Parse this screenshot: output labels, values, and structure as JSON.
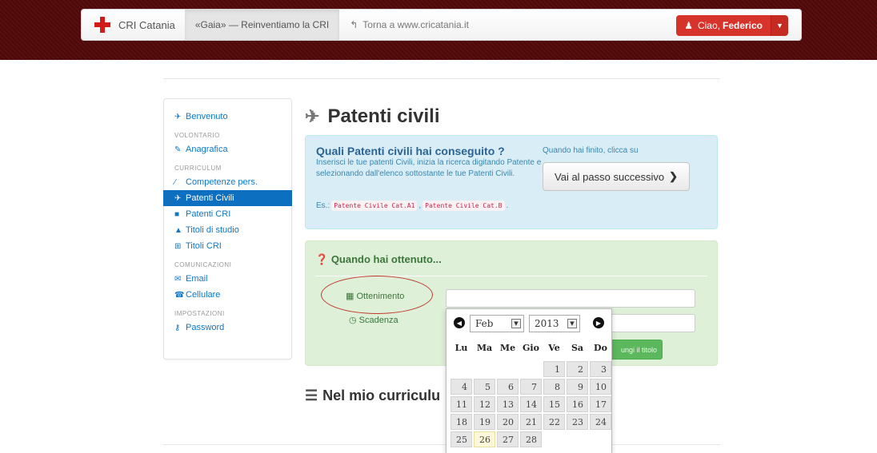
{
  "navbar": {
    "brand": "CRI Catania",
    "tab_active": "«Gaia» — Reinventiamo la CRI",
    "back_link": "Torna a www.cricatania.it",
    "user_greeting": "Ciao,",
    "user_name": "Federico"
  },
  "sidebar": {
    "welcome": "Benvenuto",
    "sections": [
      {
        "heading": "VOLONTARIO",
        "items": [
          "Anagrafica"
        ]
      },
      {
        "heading": "CURRICULUM",
        "items": [
          "Competenze pers.",
          "Patenti Civili",
          "Patenti CRI",
          "Titoli di studio",
          "Titoli CRI"
        ]
      },
      {
        "heading": "COMUNICAZIONI",
        "items": [
          "Email",
          "Cellulare"
        ]
      },
      {
        "heading": "IMPOSTAZIONI",
        "items": [
          "Password"
        ]
      }
    ],
    "active_item": "Patenti Civili"
  },
  "main": {
    "title": "Patenti civili",
    "info": {
      "title": "Quali Patenti civili hai conseguito ?",
      "text": "Inserisci le tue patenti Civili, inizia la ricerca digitando Patente e selezionando dall'elenco sottostante le tue Patenti Civili.",
      "example_prefix": "Es.:",
      "example_1": "Patente Civile Cat.A1",
      "example_sep": ",",
      "example_2": "Patente Civile Cat.B",
      "example_end": ".",
      "done_text": "Quando hai finito, clicca su",
      "next_button": "Vai al passo successivo"
    },
    "form": {
      "title": "Quando hai ottenuto...",
      "label_obtained": "Ottenimento",
      "label_expiry": "Scadenza",
      "obtained_value": "",
      "expiry_value": "",
      "add_button": "ungi il titolo"
    },
    "curriculum_title": "Nel mio curriculu"
  },
  "datepicker": {
    "month": "Feb",
    "year": "2013",
    "weekdays": [
      "Lu",
      "Ma",
      "Me",
      "Gio",
      "Ve",
      "Sa",
      "Do"
    ],
    "leading_blanks": 4,
    "days": [
      "1",
      "2",
      "3",
      "4",
      "5",
      "6",
      "7",
      "8",
      "9",
      "10",
      "11",
      "12",
      "13",
      "14",
      "15",
      "16",
      "17",
      "18",
      "19",
      "20",
      "21",
      "22",
      "23",
      "24",
      "25",
      "26",
      "27",
      "28"
    ],
    "today": "26"
  },
  "colors": {
    "navbar_band": "#5a0e0e",
    "brand_red": "#d11a1a",
    "link_blue": "#0e78c5",
    "active_blue": "#0d6fbf",
    "info_bg": "#d9edf7",
    "success_bg": "#dff0d8",
    "annotation_circle": "#c0392b"
  }
}
